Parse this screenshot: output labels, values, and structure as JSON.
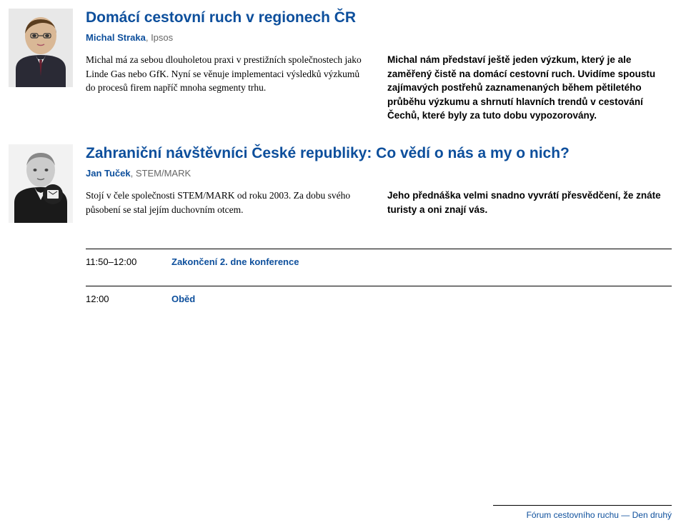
{
  "sections": [
    {
      "title": "Domácí cestovní ruch v regionech ČR",
      "speaker": "Michal Straka",
      "org": "Ipsos",
      "left": "Michal má za sebou dlouholetou praxi v prestižních společnostech jako Linde Gas nebo GfK. Nyní se věnuje implementaci výsledků výzkumů do procesů firem napříč mnoha segmenty trhu.",
      "right": "Michal nám představí ještě jeden výzkum, který je ale zaměřený čistě na domácí cestovní ruch. Uvidíme spoustu zajímavých postřehů zaznamenaných během pětiletého průběhu výzkumu a shrnutí hlavních trendů v cestování Čechů, které byly za tuto dobu vypozorovány."
    },
    {
      "title": "Zahraniční návštěvníci České republiky: Co vědí o nás a my o nich?",
      "speaker": "Jan Tuček",
      "org": "STEM/MARK",
      "left": "Stojí v čele společnosti STEM/MARK od roku 2003. Za dobu svého působení se stal jejím duchovním otcem.",
      "right": "Jeho přednáška velmi snadno vyvrátí přesvědčení, že znáte turisty a oni znají vás."
    }
  ],
  "schedule": [
    {
      "time": "11:50–12:00",
      "label": "Zakončení 2. dne konference"
    },
    {
      "time": "12:00",
      "label": "Oběd"
    }
  ],
  "footer": "Fórum cestovního ruchu — Den druhý"
}
